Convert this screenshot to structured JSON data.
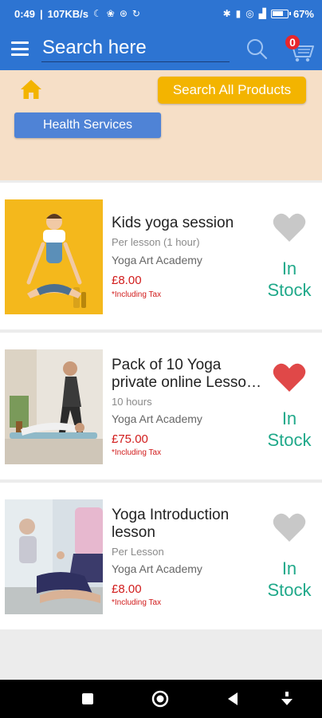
{
  "status_bar": {
    "time": "0:49",
    "net_speed": "107KB/s",
    "battery": "67"
  },
  "header": {
    "search_text": "Search here",
    "cart_count": "0"
  },
  "banner": {
    "search_all_label": "Search All Products",
    "category_label": "Health Services"
  },
  "products": [
    {
      "title": "Kids yoga session",
      "duration": "Per lesson (1 hour)",
      "vendor": "Yoga Art Academy",
      "price": "£8.00",
      "tax_note": "*Including Tax",
      "stock_line1": "In",
      "stock_line2": "Stock",
      "favorited": false
    },
    {
      "title": "Pack of 10 Yoga private online Lesso…",
      "duration": "10 hours",
      "vendor": "Yoga Art Academy",
      "price": "£75.00",
      "tax_note": "*Including Tax",
      "stock_line1": "In",
      "stock_line2": "Stock",
      "favorited": true
    },
    {
      "title": "Yoga Introduction lesson",
      "duration": "Per Lesson",
      "vendor": "Yoga Art Academy",
      "price": "£8.00",
      "tax_note": "*Including Tax",
      "stock_line1": "In",
      "stock_line2": "Stock",
      "favorited": false
    }
  ],
  "colors": {
    "primary": "#2d74d2",
    "accent_button": "#f3b400",
    "category_button": "#4f83d6",
    "banner_bg": "#f6dfc7",
    "price": "#d11c1c",
    "in_stock": "#20a98a",
    "heart_active": "#e04848",
    "heart_inactive": "#c8c8c8"
  }
}
